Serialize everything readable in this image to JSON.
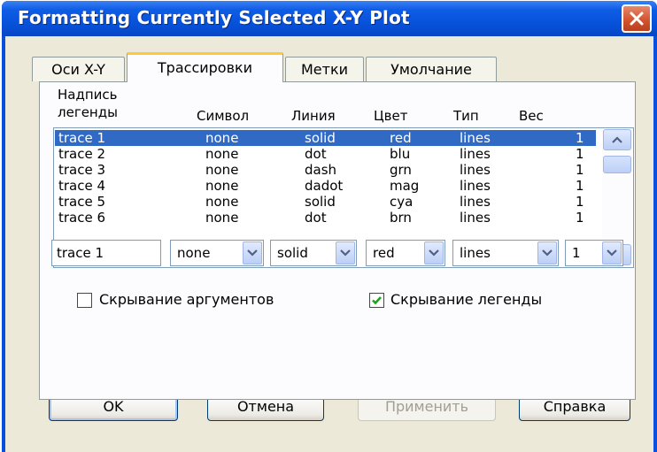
{
  "window": {
    "title": "Formatting Currently Selected X-Y Plot"
  },
  "tabs": [
    {
      "label": "Оси X-Y"
    },
    {
      "label": "Трассировки"
    },
    {
      "label": "Метки"
    },
    {
      "label": "Умолчание"
    }
  ],
  "columns": {
    "legend_line1": "Надпись",
    "legend_line2": "легенды",
    "symbol": "Символ",
    "line": "Линия",
    "color": "Цвет",
    "type": "Тип",
    "weight": "Вес"
  },
  "traces": [
    {
      "name": "trace 1",
      "symbol": "none",
      "line": "solid",
      "color": "red",
      "type": "lines",
      "weight": "1"
    },
    {
      "name": "trace 2",
      "symbol": "none",
      "line": "dot",
      "color": "blu",
      "type": "lines",
      "weight": "1"
    },
    {
      "name": "trace 3",
      "symbol": "none",
      "line": "dash",
      "color": "grn",
      "type": "lines",
      "weight": "1"
    },
    {
      "name": "trace 4",
      "symbol": "none",
      "line": "dadot",
      "color": "mag",
      "type": "lines",
      "weight": "1"
    },
    {
      "name": "trace 5",
      "symbol": "none",
      "line": "solid",
      "color": "cya",
      "type": "lines",
      "weight": "1"
    },
    {
      "name": "trace 6",
      "symbol": "none",
      "line": "dot",
      "color": "brn",
      "type": "lines",
      "weight": "1"
    }
  ],
  "editor": {
    "name": "trace 1",
    "symbol": "none",
    "line": "solid",
    "color": "red",
    "type": "lines",
    "weight": "1"
  },
  "checkboxes": {
    "hide_args": {
      "label": "Скрывание аргументов",
      "checked": false
    },
    "hide_legend": {
      "label": "Скрывание легенды",
      "checked": true
    }
  },
  "buttons": {
    "ok": "OK",
    "cancel": "Отмена",
    "apply": "Применить",
    "help": "Справка"
  },
  "colors": {
    "titlebar": "#0650d8",
    "selection": "#316ac5",
    "face": "#ece9d8",
    "check": "#21a121"
  }
}
